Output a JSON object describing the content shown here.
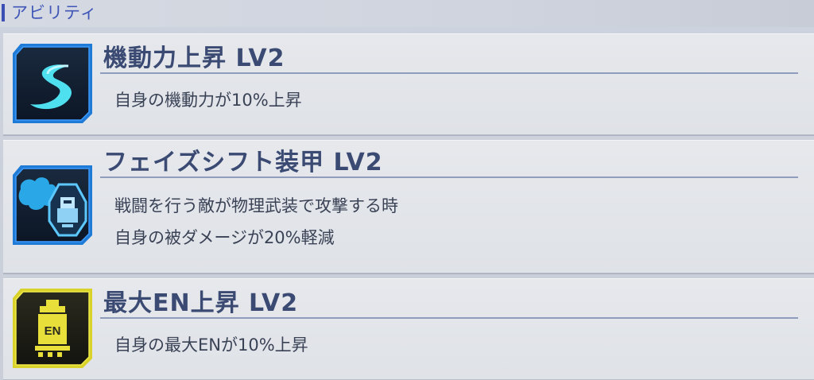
{
  "section": {
    "title": "アビリティ"
  },
  "abilities": [
    {
      "title": "機動力上昇 LV2",
      "icon": "mobility-swoosh-icon",
      "description": [
        "自身の機動力が10%上昇"
      ]
    },
    {
      "title": "フェイズシフト装甲 LV2",
      "icon": "phase-shift-armor-icon",
      "description": [
        "戦闘を行う敵が物理武装で攻撃する時",
        "自身の被ダメージが20%軽減"
      ]
    },
    {
      "title": "最大EN上昇 LV2",
      "icon": "en-battery-icon",
      "icon_text": "EN",
      "description": [
        "自身の最大ENが10%上昇"
      ]
    }
  ],
  "colors": {
    "accent": "#3f56b8",
    "title_text": "#3a4a72",
    "blue_icon_frame": "#1f7bd6",
    "yellow_icon_frame": "#d8d22a"
  }
}
